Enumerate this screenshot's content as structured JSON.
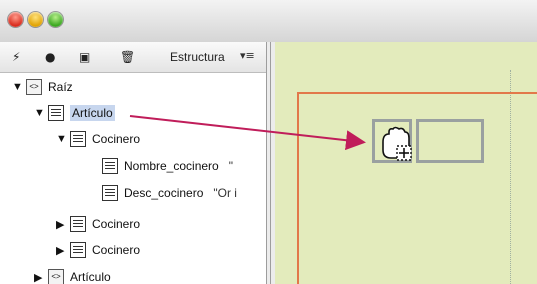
{
  "toolbar": {
    "structure_label": "Estructura",
    "menu_label": "▾≡"
  },
  "tree": {
    "root_label": "Raíz",
    "articulo_selected": "Artículo",
    "cocinero_1": "Cocinero",
    "nombre_cocinero": "Nombre_cocinero",
    "nombre_value": "\"",
    "desc_cocinero": "Desc_cocinero",
    "desc_value": "\"Or i",
    "cocinero_2": "Cocinero",
    "cocinero_3": "Cocinero",
    "articulo_2": "Artículo"
  },
  "colors": {
    "accent": "#c01d5a",
    "canvas_bg": "#e3ebbc",
    "frame": "#e2784a"
  }
}
